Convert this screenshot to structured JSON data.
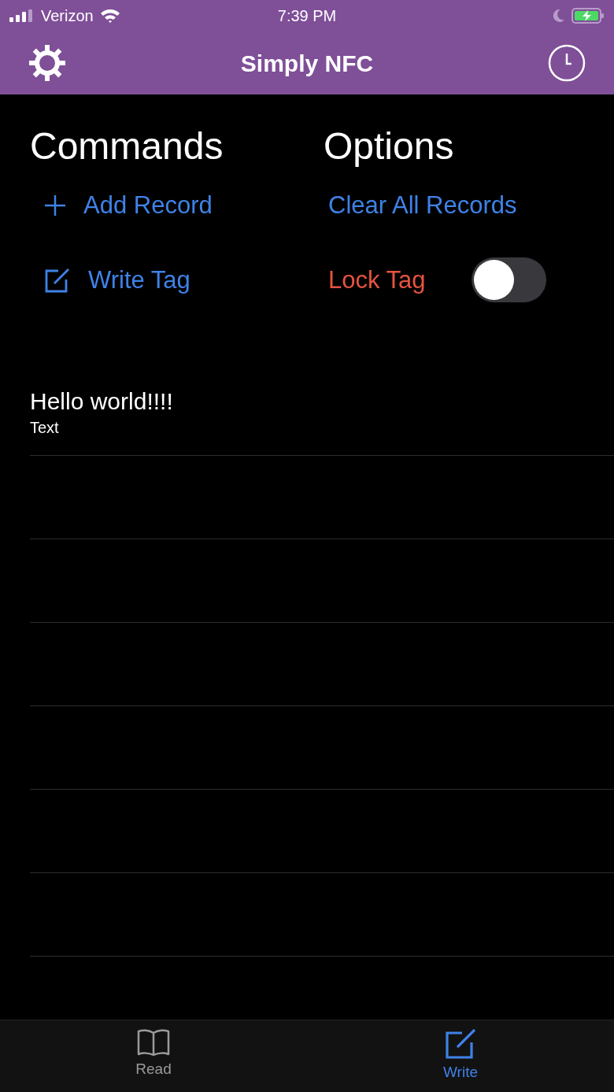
{
  "status_bar": {
    "carrier": "Verizon",
    "time": "7:39 PM"
  },
  "nav": {
    "title": "Simply NFC"
  },
  "commands": {
    "heading": "Commands",
    "items": [
      {
        "kind": "add",
        "label": "Add Record"
      },
      {
        "kind": "write",
        "label": "Write Tag"
      }
    ]
  },
  "options": {
    "heading": "Options",
    "clear_label": "Clear All Records",
    "lock": {
      "label": "Lock Tag",
      "on": false
    }
  },
  "records": [
    {
      "title": "Hello world!!!!",
      "type": "Text"
    }
  ],
  "tabs": [
    {
      "kind": "read",
      "label": "Read",
      "selected": false
    },
    {
      "kind": "write",
      "label": "Write",
      "selected": true
    }
  ]
}
